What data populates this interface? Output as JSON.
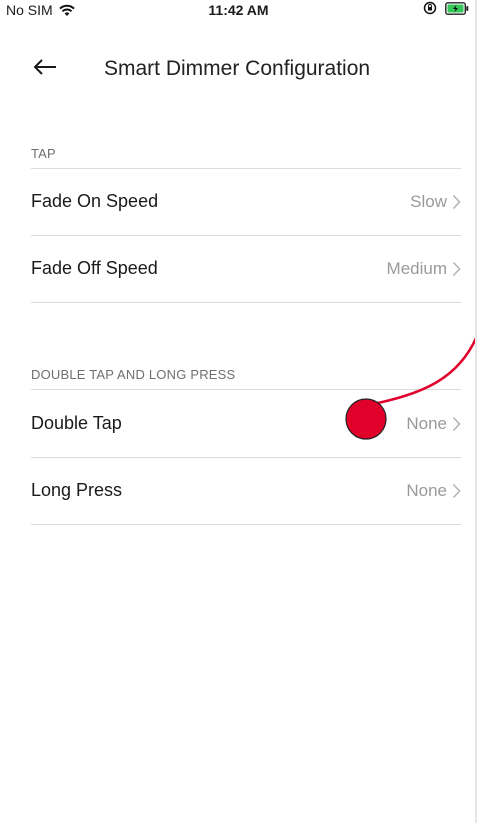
{
  "status": {
    "carrier": "No SIM",
    "time": "11:42 AM",
    "icons": [
      "wifi-icon",
      "orientation-lock-icon",
      "battery-charging-icon"
    ]
  },
  "nav": {
    "title": "Smart Dimmer Configuration",
    "back_icon": "back-arrow-icon"
  },
  "sections": [
    {
      "header": "TAP",
      "rows": [
        {
          "label": "Fade On Speed",
          "value": "Slow"
        },
        {
          "label": "Fade Off Speed",
          "value": "Medium"
        }
      ]
    },
    {
      "header": "DOUBLE TAP AND LONG PRESS",
      "rows": [
        {
          "label": "Double Tap",
          "value": "None"
        },
        {
          "label": "Long Press",
          "value": "None"
        }
      ]
    }
  ],
  "annotation": {
    "marker_color": "#e0002a"
  }
}
